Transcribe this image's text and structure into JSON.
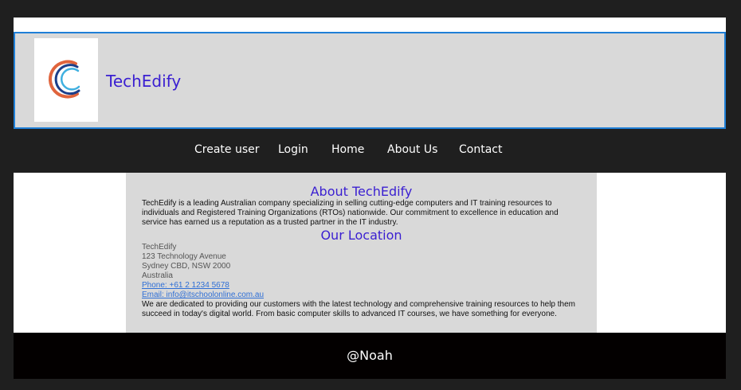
{
  "header": {
    "brand": "TechEdify",
    "logo_icon": "swirl-logo-icon",
    "border_color": "#1f7fd6"
  },
  "nav": {
    "items": [
      {
        "label": "Create user"
      },
      {
        "label": "Login"
      },
      {
        "label": "Home"
      },
      {
        "label": "About Us"
      },
      {
        "label": "Contact"
      }
    ]
  },
  "about": {
    "title": "About TechEdify",
    "text": "TechEdify is a leading Australian company specializing in selling cutting-edge computers and IT training resources to individuals and Registered Training Organizations (RTOs) nationwide. Our commitment to excellence in education and service has earned us a reputation as a trusted partner in the IT industry."
  },
  "location": {
    "title": "Our Location",
    "address_lines": [
      "TechEdify",
      "123 Technology Avenue",
      "Sydney CBD, NSW 2000",
      "Australia"
    ],
    "phone": "Phone: +61 2 1234 5678",
    "email": "Email: info@itschoolonline.com.au",
    "tagline": "We are dedicated to providing our customers with the latest technology and comprehensive training resources to help them succeed in today's digital world. From basic computer skills to advanced IT courses, we have something for everyone."
  },
  "footer": {
    "text": "@Noah"
  },
  "colors": {
    "accent": "#3a1fd1",
    "link": "#2f6fd6",
    "footer_bg": "#030000"
  }
}
